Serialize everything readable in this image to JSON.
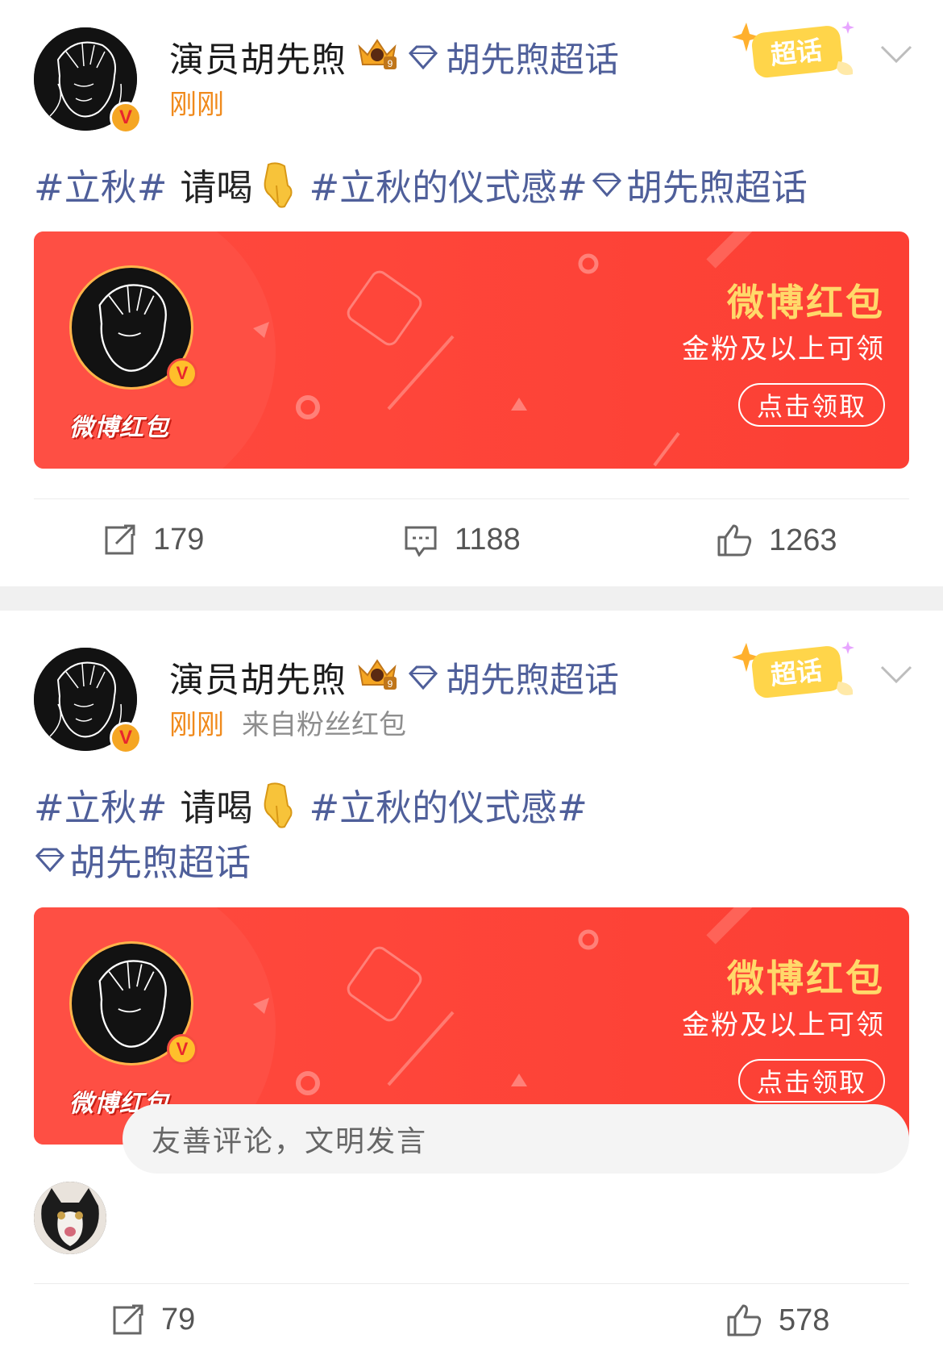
{
  "posts": [
    {
      "author": "演员胡先煦",
      "supertopic_link": "胡先煦超话",
      "supertopic_badge": "超话",
      "time": "刚刚",
      "source": "",
      "content": {
        "tag1": "#立秋#",
        "text": "请喝",
        "tag2": "#立秋的仪式感#",
        "topic": "胡先煦超话"
      },
      "redpacket": {
        "logo": "微博红包",
        "title": "微博红包",
        "subtitle": "金粉及以上可领",
        "button": "点击领取"
      },
      "actions": {
        "reposts": "179",
        "comments": "1188",
        "likes": "1263"
      }
    },
    {
      "author": "演员胡先煦",
      "supertopic_link": "胡先煦超话",
      "supertopic_badge": "超话",
      "time": "刚刚",
      "source": "来自粉丝红包",
      "content": {
        "tag1": "#立秋#",
        "text": "请喝",
        "tag2": "#立秋的仪式感#",
        "topic": "胡先煦超话"
      },
      "redpacket": {
        "logo": "微博红包",
        "title": "微博红包",
        "subtitle": "金粉及以上可领",
        "button": "点击领取"
      },
      "comment_placeholder": "友善评论，文明发言",
      "actions": {
        "reposts": "79",
        "likes": "578"
      }
    }
  ],
  "icons": {
    "verified": "V",
    "crown_level": "9"
  },
  "colors": {
    "link": "#4f5f9a",
    "time": "#f08a1c",
    "redpacket": "#fc3f34",
    "gold": "#ffd96a"
  }
}
